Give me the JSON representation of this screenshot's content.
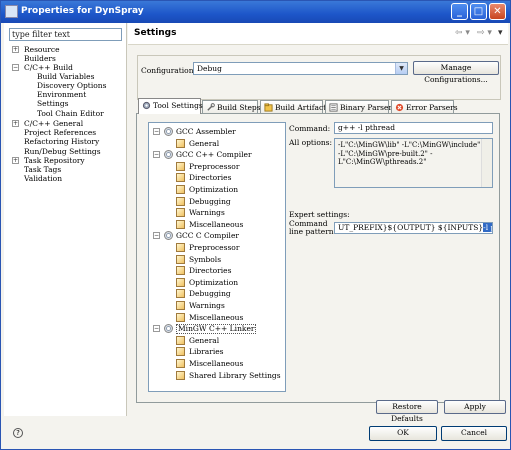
{
  "window": {
    "title": "Properties for DynSpray",
    "controls": [
      "minimize",
      "maximize",
      "close"
    ]
  },
  "left": {
    "filter_placeholder": "type filter text",
    "items": [
      {
        "label": "Resource",
        "expander": "+"
      },
      {
        "label": "Builders",
        "expander": ""
      },
      {
        "label": "C/C++ Build",
        "expander": "−"
      },
      {
        "label": "Build Variables",
        "expander": ""
      },
      {
        "label": "Discovery Options",
        "expander": ""
      },
      {
        "label": "Environment",
        "expander": ""
      },
      {
        "label": "Settings",
        "expander": ""
      },
      {
        "label": "Tool Chain Editor",
        "expander": ""
      },
      {
        "label": "C/C++ General",
        "expander": "+"
      },
      {
        "label": "Project References",
        "expander": ""
      },
      {
        "label": "Refactoring History",
        "expander": ""
      },
      {
        "label": "Run/Debug Settings",
        "expander": ""
      },
      {
        "label": "Task Repository",
        "expander": "+"
      },
      {
        "label": "Task Tags",
        "expander": ""
      },
      {
        "label": "Validation",
        "expander": ""
      }
    ]
  },
  "header": {
    "title": "Settings",
    "back_icon": "back-arrow-icon",
    "forward_icon": "forward-arrow-icon",
    "menu_icon": "chevron-down-icon"
  },
  "config": {
    "label": "Configuration:",
    "value": "Debug",
    "manage_label": "Manage Configurations..."
  },
  "tabs": [
    {
      "label": "Tool Settings",
      "active": true,
      "icon": "gear-icon"
    },
    {
      "label": "Build Steps",
      "active": false,
      "icon": "wrench-icon"
    },
    {
      "label": "Build Artifact",
      "active": false,
      "icon": "artifact-icon"
    },
    {
      "label": "Binary Parsers",
      "active": false,
      "icon": "binary-icon"
    },
    {
      "label": "Error Parsers",
      "active": false,
      "icon": "error-icon"
    }
  ],
  "tools": [
    {
      "label": "GCC Assembler",
      "type": "tool",
      "expander": "−"
    },
    {
      "label": "General",
      "type": "option"
    },
    {
      "label": "GCC C++ Compiler",
      "type": "tool",
      "expander": "−"
    },
    {
      "label": "Preprocessor",
      "type": "option"
    },
    {
      "label": "Directories",
      "type": "option"
    },
    {
      "label": "Optimization",
      "type": "option"
    },
    {
      "label": "Debugging",
      "type": "option"
    },
    {
      "label": "Warnings",
      "type": "option"
    },
    {
      "label": "Miscellaneous",
      "type": "option"
    },
    {
      "label": "GCC C Compiler",
      "type": "tool",
      "expander": "−"
    },
    {
      "label": "Preprocessor",
      "type": "option"
    },
    {
      "label": "Symbols",
      "type": "option"
    },
    {
      "label": "Directories",
      "type": "option"
    },
    {
      "label": "Optimization",
      "type": "option"
    },
    {
      "label": "Debugging",
      "type": "option"
    },
    {
      "label": "Warnings",
      "type": "option"
    },
    {
      "label": "Miscellaneous",
      "type": "option"
    },
    {
      "label": "MinGW C++ Linker",
      "type": "tool",
      "expander": "−",
      "selected": true
    },
    {
      "label": "General",
      "type": "option"
    },
    {
      "label": "Libraries",
      "type": "option"
    },
    {
      "label": "Miscellaneous",
      "type": "option"
    },
    {
      "label": "Shared Library Settings",
      "type": "option"
    }
  ],
  "command": {
    "label": "Command:",
    "value": "g++ -l pthread"
  },
  "all_options": {
    "label": "All options:",
    "lines": [
      "-L\"C:\\MinGW\\lib\" -L\"C:\\MinGW\\include\"",
      "-L\"C:\\MinGW\\pre-built.2\" -",
      "L\"C:\\MinGW\\pthreads.2\""
    ]
  },
  "expert": {
    "label": "Expert settings:",
    "pattern_label_1": "Command",
    "pattern_label_2": "line pattern:",
    "pattern_value": "UT_PREFIX}${OUTPUT} ${INPUTS}",
    "pattern_selected": "-l pthread"
  },
  "buttons": {
    "restore_defaults": "Restore Defaults",
    "apply": "Apply",
    "ok": "OK",
    "cancel": "Cancel"
  }
}
